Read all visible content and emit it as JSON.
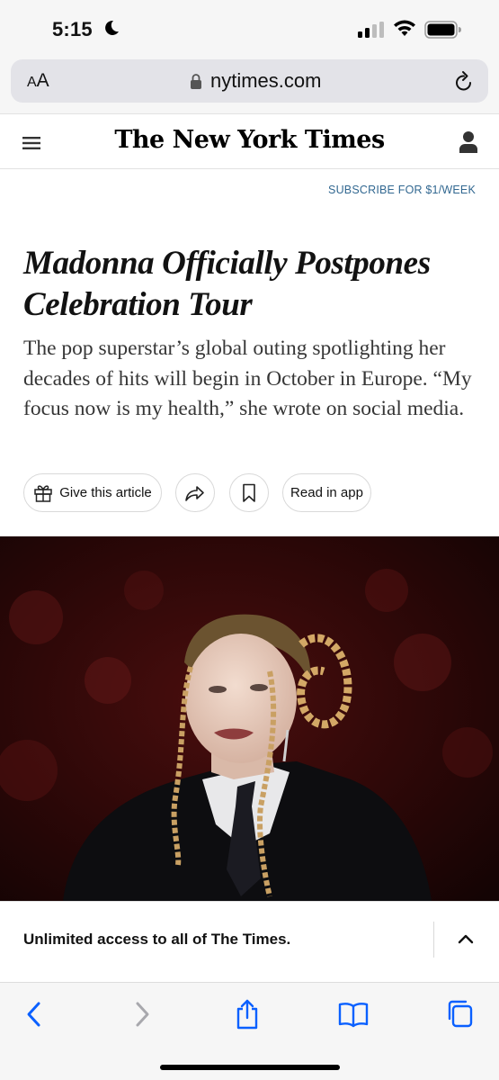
{
  "status_bar": {
    "time": "5:15",
    "focus_icon": "moon-icon",
    "signal_icon": "cellular-signal-icon",
    "wifi_icon": "wifi-icon",
    "battery_icon": "battery-icon"
  },
  "browser": {
    "text_size_small": "A",
    "text_size_large": "A",
    "url": "nytimes.com",
    "reload_icon": "reload-icon"
  },
  "header": {
    "logo": "The New York Times",
    "menu_icon": "hamburger-menu-icon",
    "account_icon": "account-icon"
  },
  "subscribe_label": "SUBSCRIBE FOR $1/WEEK",
  "article": {
    "headline": "Madonna Officially Postpones Celebration Tour",
    "summary": "The pop superstar’s global outing spotlighting her decades of hits will begin in October in Europe. “My focus now is my health,” she wrote on social media.",
    "actions": {
      "gift_label": "Give this article",
      "read_in_app_label": "Read in app"
    }
  },
  "promo": {
    "text": "Unlimited access to all of The Times."
  },
  "toolbar": {
    "icons": [
      "back-icon",
      "forward-icon",
      "share-icon",
      "bookmarks-icon",
      "tabs-icon"
    ]
  },
  "colors": {
    "link_blue": "#326891",
    "safari_blue": "#0a60ff",
    "text": "#121212"
  }
}
